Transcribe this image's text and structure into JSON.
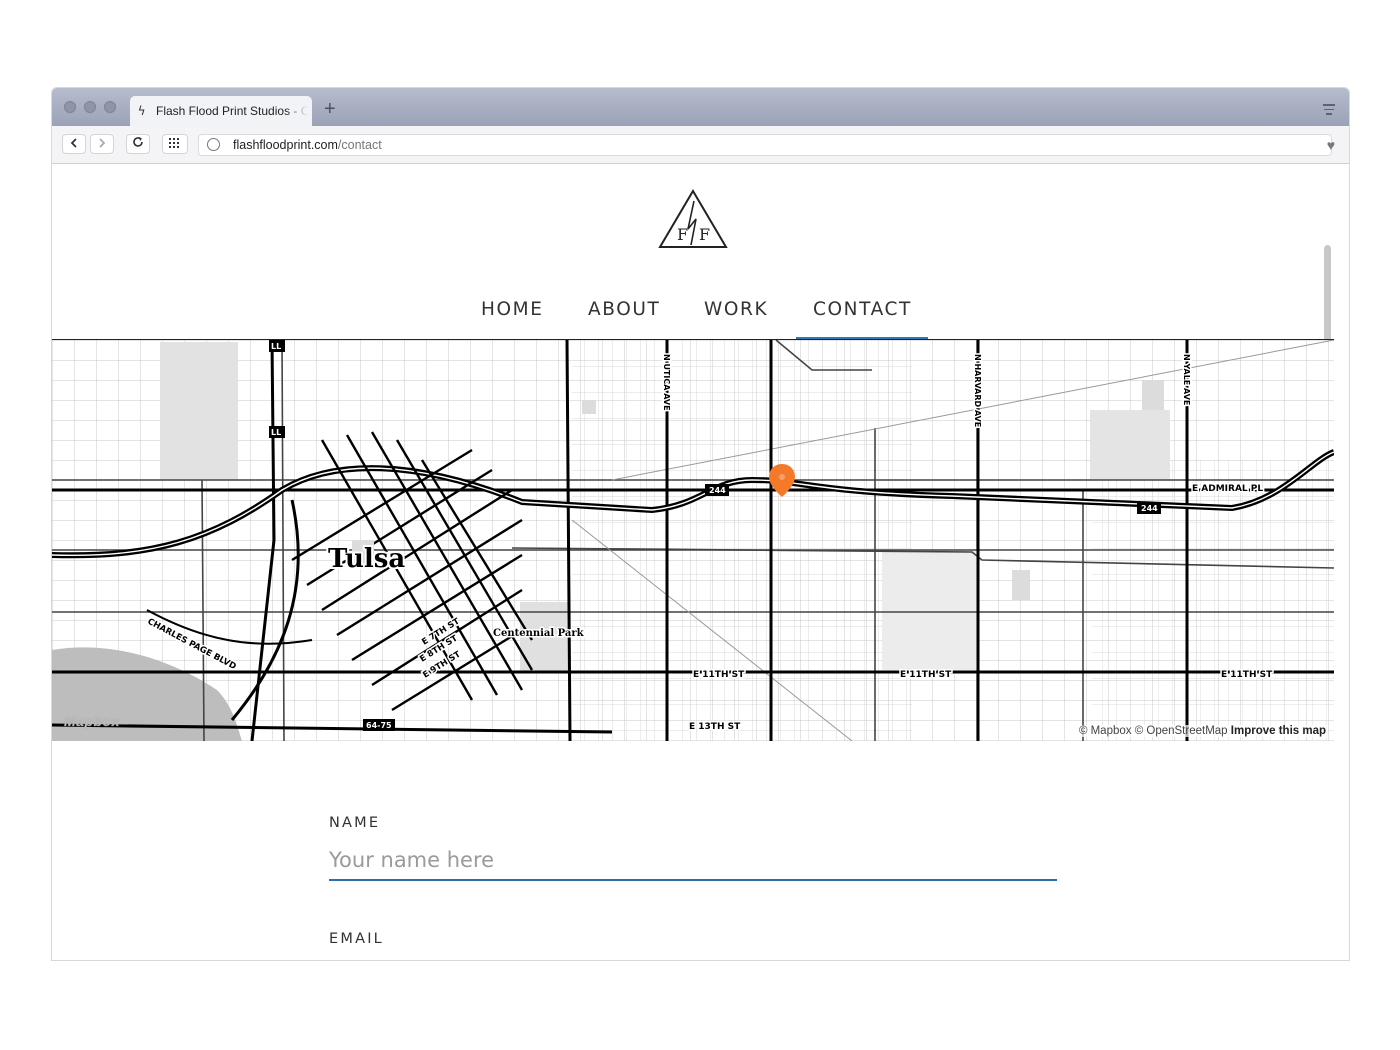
{
  "browser": {
    "tab_title": "Flash Flood Print Studios - Contact",
    "favicon": "lightning-bolt-icon",
    "new_tab": "+",
    "url_host": "flashfloodprint.com",
    "url_path": "/contact"
  },
  "site": {
    "logo_text": "FfF",
    "nav": [
      {
        "label": "HOME"
      },
      {
        "label": "ABOUT"
      },
      {
        "label": "WORK"
      },
      {
        "label": "CONTACT",
        "active": true
      }
    ],
    "accent_color": "#2e7ab8"
  },
  "map": {
    "city_label": "Tulsa",
    "labels": {
      "n_utica": "N UTICA AVE",
      "n_harvard": "N HARVARD AVE",
      "n_yale": "N YALE AVE",
      "admiral": "E ADMIRAL PL",
      "e11_a": "E 11TH ST",
      "e11_b": "E 11TH ST",
      "e11_c": "E 11TH ST",
      "e13": "E 13TH ST",
      "charles_page": "CHARLES PAGE BLVD",
      "centennial": "Centennial Park",
      "e7": "E 7TH ST",
      "e8": "E 8TH ST",
      "e9": "E 9TH ST",
      "shield_244a": "244",
      "shield_244b": "244",
      "shield_64": "64-75",
      "shield_ll1": "LL",
      "shield_ll2": "LL"
    },
    "logo": "Mapbox",
    "attribution": "© Mapbox © OpenStreetMap",
    "improve": "Improve this map",
    "marker_color": "#f47a2a"
  },
  "form": {
    "name_label": "NAME",
    "name_placeholder": "Your name here",
    "email_label": "EMAIL"
  }
}
